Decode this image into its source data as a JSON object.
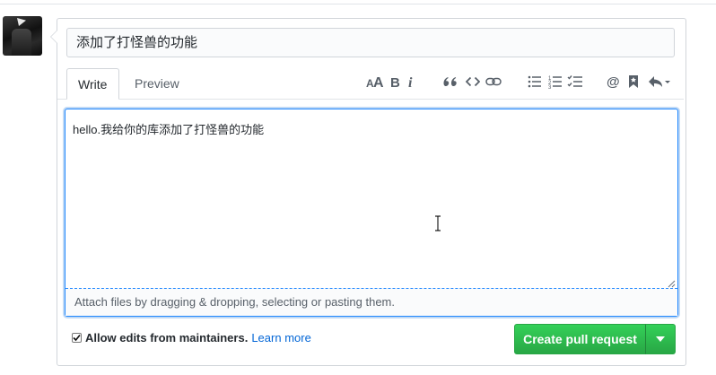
{
  "title_input": {
    "value": "添加了打怪兽的功能"
  },
  "tabs": {
    "write": "Write",
    "preview": "Preview"
  },
  "toolbar": {
    "icons": [
      "header-icon",
      "bold-icon",
      "italic-icon",
      "quote-icon",
      "code-icon",
      "link-icon",
      "unordered-list-icon",
      "ordered-list-icon",
      "task-list-icon",
      "mention-icon",
      "saved-reply-icon",
      "reply-icon"
    ]
  },
  "body": {
    "text": "hello.我给你的库添加了打怪兽的功能",
    "attach_hint": "Attach files by dragging & dropping, selecting or pasting them."
  },
  "footer": {
    "allow_edits_checked": true,
    "allow_edits_label": "Allow edits from maintainers.",
    "learn_more": "Learn more",
    "create_button": "Create pull request"
  },
  "colors": {
    "primary_green": "#28a745",
    "focus_blue": "#2188ff",
    "link_blue": "#0366d6",
    "icon_gray": "#586069"
  }
}
